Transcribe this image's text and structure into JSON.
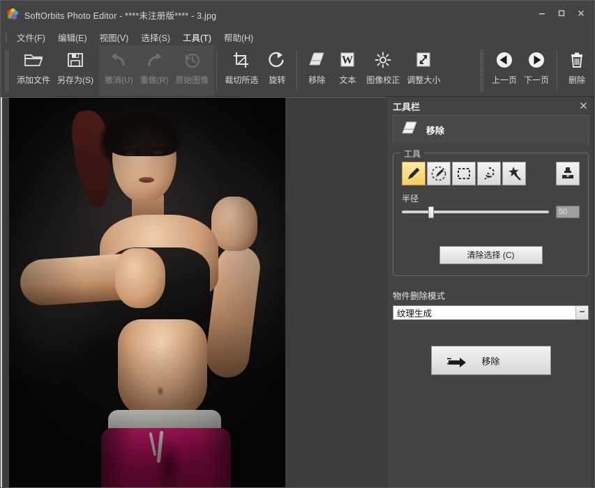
{
  "window": {
    "title": "SoftOrbits Photo Editor - ****未注册版**** - 3.jpg",
    "app_icon": "butterfly-logo",
    "minimize": "minimize-icon",
    "maximize": "maximize-icon",
    "close": "close-icon"
  },
  "menubar": {
    "items": [
      {
        "label": "文件(F)",
        "active": false
      },
      {
        "label": "编辑(E)",
        "active": false
      },
      {
        "label": "视图(V)",
        "active": false
      },
      {
        "label": "选择(S)",
        "active": false
      },
      {
        "label": "工具(T)",
        "active": true
      },
      {
        "label": "帮助(H)",
        "active": false
      }
    ]
  },
  "toolbar": {
    "groups": [
      {
        "name": "file-group",
        "disabled": false,
        "buttons": [
          {
            "label": "添加文件",
            "icon": "open-folder-icon",
            "disabled": false
          },
          {
            "label": "另存为(S)",
            "icon": "save-disk-icon",
            "disabled": false
          }
        ]
      },
      {
        "name": "history-group",
        "disabled": true,
        "buttons": [
          {
            "label": "撤消(U)",
            "icon": "undo-arrow-icon",
            "disabled": true
          },
          {
            "label": "重做(R)",
            "icon": "redo-arrow-icon",
            "disabled": true
          },
          {
            "label": "原始图像",
            "icon": "clock-revert-icon",
            "disabled": true
          }
        ]
      },
      {
        "name": "transform-group",
        "disabled": false,
        "buttons": [
          {
            "label": "裁切所选",
            "icon": "crop-icon",
            "disabled": false
          },
          {
            "label": "旋转",
            "icon": "rotate-icon",
            "disabled": false
          }
        ]
      },
      {
        "name": "edit-group",
        "disabled": false,
        "buttons": [
          {
            "label": "移除",
            "icon": "eraser-icon",
            "disabled": false
          },
          {
            "label": "文本",
            "icon": "text-w-icon",
            "disabled": false
          },
          {
            "label": "图像校正",
            "icon": "brightness-sun-icon",
            "disabled": false
          },
          {
            "label": "调整大小",
            "icon": "resize-arrow-icon",
            "disabled": false
          }
        ]
      },
      {
        "name": "navigation-group",
        "disabled": false,
        "buttons": [
          {
            "label": "上一页",
            "icon": "prev-page-icon",
            "disabled": false
          },
          {
            "label": "下一页",
            "icon": "next-page-icon",
            "disabled": false
          }
        ]
      },
      {
        "name": "delete-group",
        "disabled": false,
        "buttons": [
          {
            "label": "删除",
            "icon": "trash-icon",
            "disabled": false
          }
        ]
      }
    ]
  },
  "canvas": {
    "image_name": "3.jpg",
    "background_color": "#3c3c3c"
  },
  "panel": {
    "title": "工具栏",
    "close_icon": "close-icon",
    "section": {
      "icon": "eraser-icon",
      "label": "移除"
    },
    "tools_group": {
      "legend": "工具",
      "tools": [
        {
          "name": "brush-tool",
          "icon": "pencil-icon",
          "selected": true
        },
        {
          "name": "eraser-tool",
          "icon": "dashed-eraser-icon",
          "selected": false
        },
        {
          "name": "rectangle-select-tool",
          "icon": "rectangle-marquee-icon",
          "selected": false
        },
        {
          "name": "lasso-tool",
          "icon": "lasso-icon",
          "selected": false
        },
        {
          "name": "magic-wand-tool",
          "icon": "magic-wand-icon",
          "selected": false
        },
        {
          "name": "clone-stamp-tool",
          "icon": "clone-stamp-icon",
          "selected": false
        }
      ],
      "radius_label": "半径",
      "radius_value": "50",
      "radius_percent": 18,
      "clear_button": "清除选择 (C)"
    },
    "mode": {
      "label": "物件删除模式",
      "value": "纹理生成",
      "dropdown_icon": "chevron-down-icon"
    },
    "remove_button": {
      "label": "移除",
      "icon": "arrow-right-icon"
    }
  },
  "colors": {
    "chrome": "#434343",
    "panel_bg": "#454545",
    "canvas_bg": "#3c3c3c",
    "accent_selected": "#f5ce62",
    "text": "#d9d9d9"
  }
}
